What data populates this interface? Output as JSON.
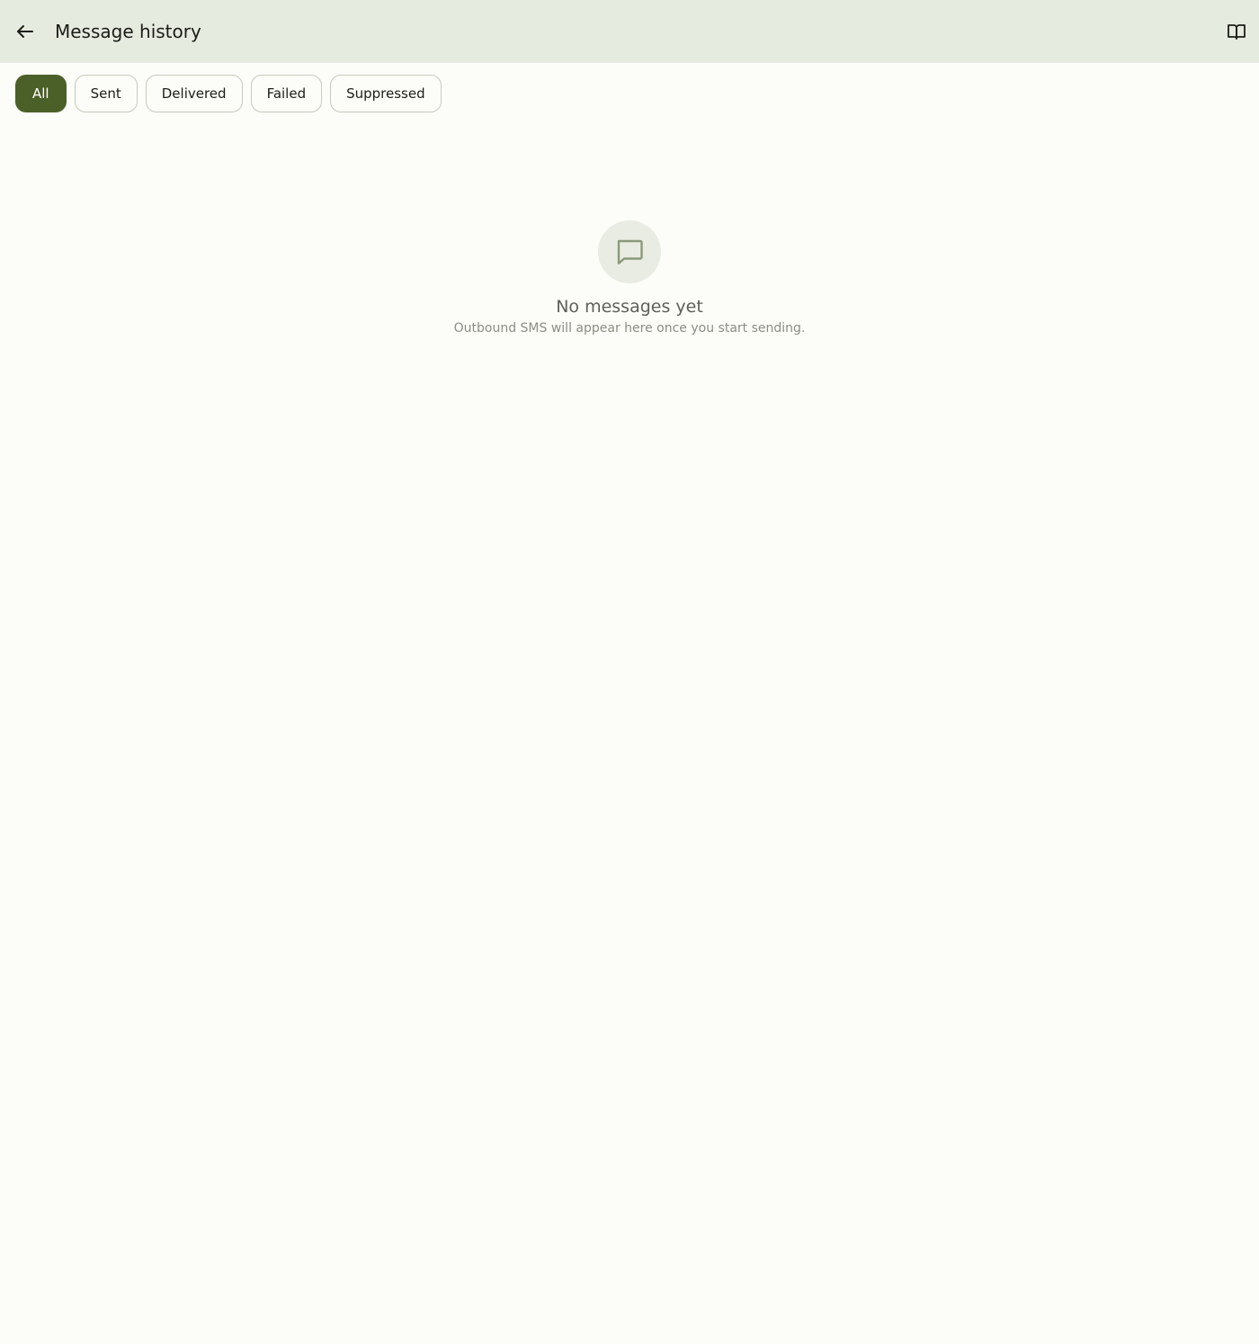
{
  "app_bar": {
    "title": "Message history",
    "back_icon": "arrow-left-icon",
    "help_icon": "book-open-icon"
  },
  "filters": {
    "selected": "All",
    "chips": [
      {
        "label": "All"
      },
      {
        "label": "Sent"
      },
      {
        "label": "Delivered"
      },
      {
        "label": "Failed"
      },
      {
        "label": "Suppressed"
      }
    ]
  },
  "empty_state": {
    "icon": "message-square-icon",
    "title": "No messages yet",
    "subtitle": "Outbound SMS will appear here once you start sending."
  },
  "colors": {
    "background": "#fcfdf8",
    "app_bar": "#e6ebe0",
    "accent": "#4b5f29",
    "icon_muted": "#8a9a78"
  }
}
